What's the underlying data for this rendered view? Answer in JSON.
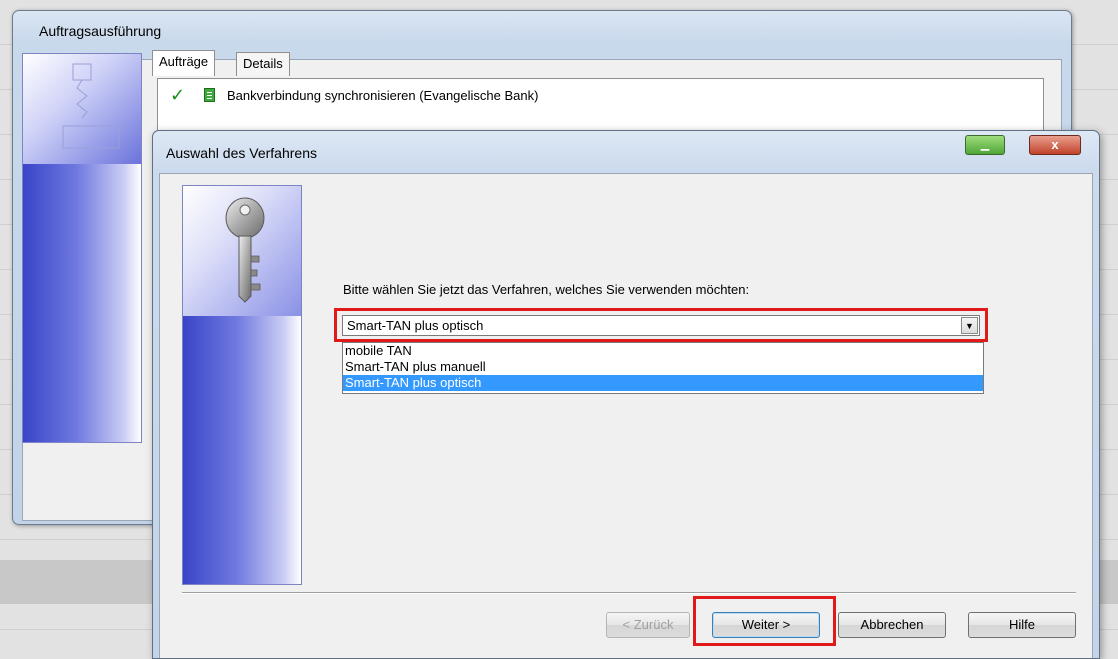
{
  "back_window": {
    "title": "Auftragsausführung",
    "tabs": [
      {
        "label": "Aufträge"
      },
      {
        "label": "Details"
      }
    ],
    "rows": [
      {
        "status_icon": "check-icon",
        "item_icon": "document-icon",
        "text": "Bankverbindung synchronisieren (Evangelische Bank)"
      }
    ]
  },
  "dialog": {
    "title": "Auswahl des Verfahrens",
    "prompt": "Bitte wählen Sie jetzt das Verfahren, welches Sie verwenden möchten:",
    "combo": {
      "selected": "Smart-TAN plus optisch",
      "options": [
        "mobile TAN",
        "Smart-TAN plus manuell",
        "Smart-TAN plus optisch"
      ]
    },
    "buttons": {
      "back": "< Zurück",
      "next": "Weiter >",
      "cancel": "Abbrechen",
      "help": "Hilfe"
    },
    "close_glyph": "x"
  },
  "colors": {
    "highlight": "#e01919",
    "selection": "#3399ff",
    "check": "#1a8a1a"
  }
}
